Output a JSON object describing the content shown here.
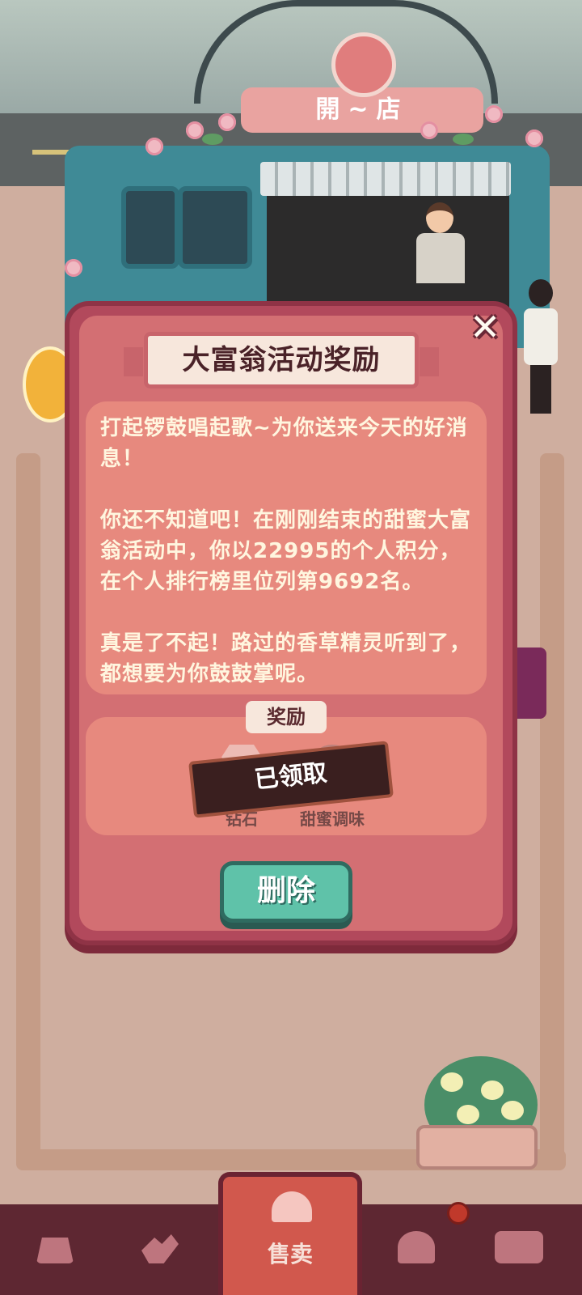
{
  "shop": {
    "sign_text": "開~店"
  },
  "dialog": {
    "title": "大富翁活动奖励",
    "close_symbol": "✕",
    "message": {
      "paragraph_1": "打起锣鼓唱起歌~为你送来今天的好消息！",
      "paragraph_2": "你还不知道吧！在刚刚结束的甜蜜大富翁活动中，你以22995的个人积分，在个人排行榜里位列第9692名。",
      "paragraph_3": "真是了不起！路过的香草精灵听到了，都想要为你鼓鼓掌呢。"
    },
    "reward_section_label": "奖励",
    "rewards": [
      {
        "name": "钻石",
        "icon": "diamond-icon"
      },
      {
        "name": "甜蜜调味",
        "icon": "syrup-icon"
      }
    ],
    "claimed_stamp": "已领取",
    "delete_button": "删除"
  },
  "bottom_nav": {
    "items": [
      {
        "icon": "bag-icon"
      },
      {
        "icon": "handshake-icon"
      },
      {
        "icon": "service-bell-icon",
        "label": "售卖",
        "selected": true
      },
      {
        "icon": "person-icon",
        "has_notification": true
      },
      {
        "icon": "bus-icon"
      }
    ]
  }
}
